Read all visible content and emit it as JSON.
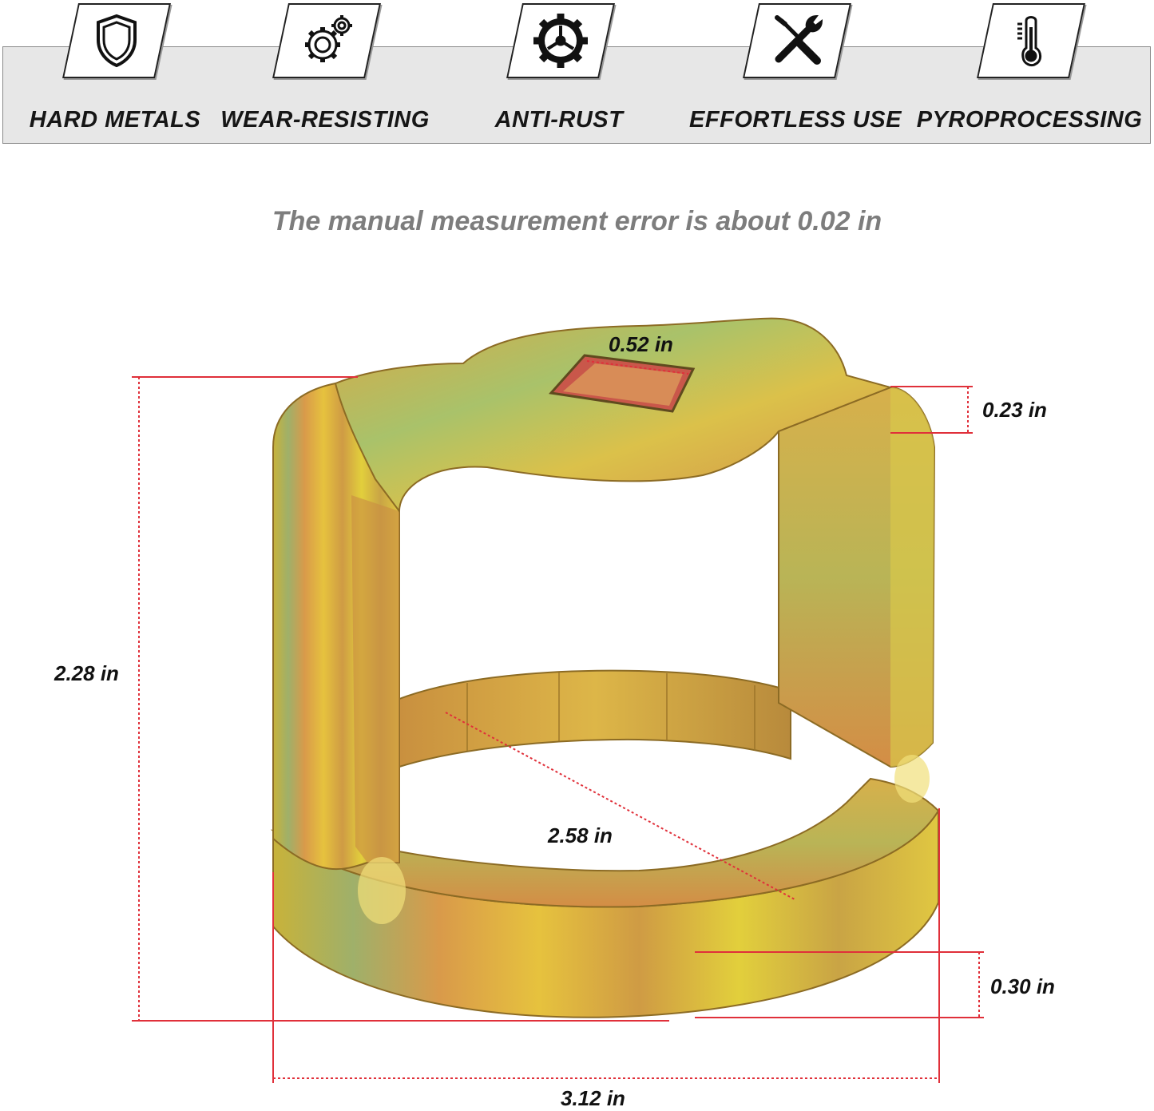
{
  "features": [
    {
      "label": "HARD METALS",
      "icon": "shield-icon"
    },
    {
      "label": "WEAR-RESISTING",
      "icon": "gears-icon"
    },
    {
      "label": "ANTI-RUST",
      "icon": "gear-icon"
    },
    {
      "label": "EFFORTLESS USE",
      "icon": "wrench-screwdriver-icon"
    },
    {
      "label": "PYROPROCESSING",
      "icon": "thermometer-icon"
    }
  ],
  "note": "The manual measurement error is about 0.02 in",
  "dimensions": {
    "square_drive": "0.52 in",
    "top_thickness": "0.23 in",
    "height": "2.28 in",
    "inner_diameter": "2.58 in",
    "bottom_band": "0.30 in",
    "outer_width": "3.12 in"
  },
  "colors": {
    "dimension_line": "#e0303a",
    "banner_bg": "#e7e7e7",
    "note_text": "#7d7d7d"
  }
}
